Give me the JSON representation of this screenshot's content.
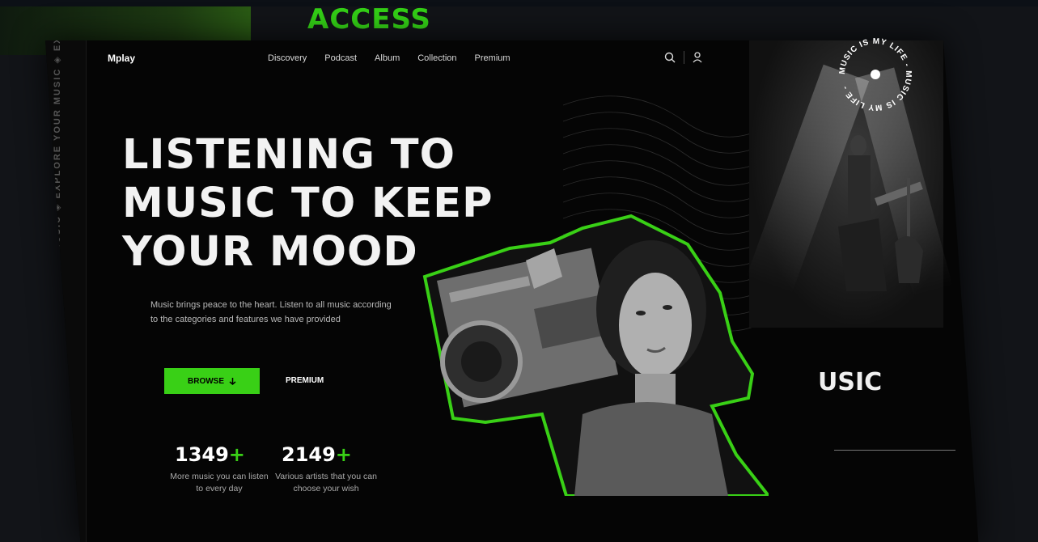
{
  "banner": {
    "title": "ACCESS"
  },
  "nav": {
    "logo": "Mplay",
    "links": [
      "Discovery",
      "Podcast",
      "Album",
      "Collection",
      "Premium"
    ],
    "search_icon": "search-icon",
    "user_icon": "user-icon"
  },
  "side_rail": {
    "text": "EXPLORE YOUR MUSIC ◈ EXPLORE YOUR MUSIC ◈ EXPLORE YOUR MUSIC ◈ EXPLORE"
  },
  "hero": {
    "headline_lines": [
      "LISTENING TO",
      "MUSIC TO KEEP",
      "YOUR MOOD"
    ],
    "description": "Music brings peace to the heart. Listen to all music according to the categories and features we have provided",
    "browse_label": "BROWSE",
    "premium_label": "PREMIUM"
  },
  "stats": [
    {
      "number": "1349",
      "plus": "+",
      "label": "More music you can listen to every day"
    },
    {
      "number": "2149",
      "plus": "+",
      "label": "Various artists that you can choose your wish"
    }
  ],
  "badge": {
    "text": "MUSIC IS MY LIFE - MUSIC IS MY LIFE - "
  },
  "right_panel": {
    "label": "USIC"
  },
  "colors": {
    "accent": "#39d016",
    "background": "#050505"
  }
}
